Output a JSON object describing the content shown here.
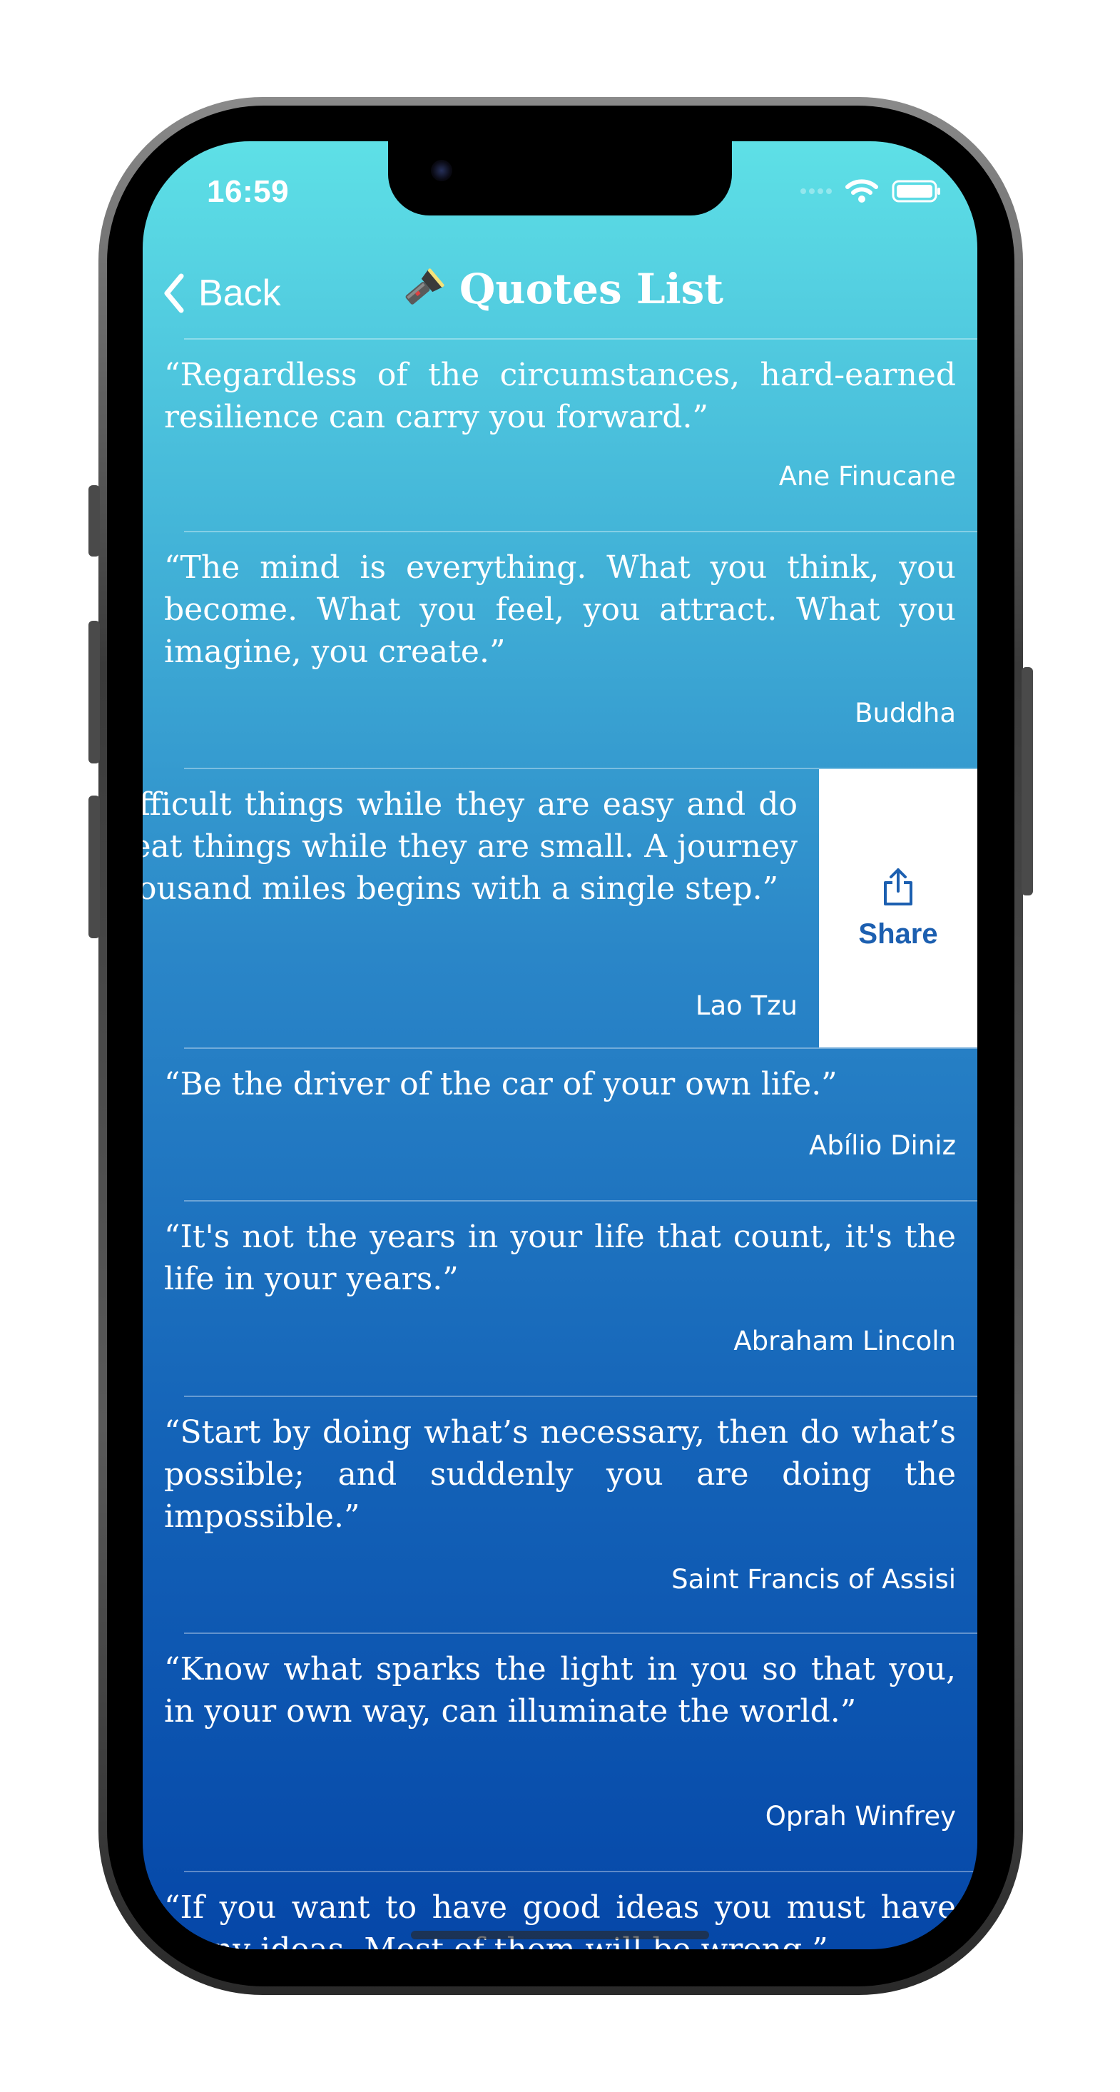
{
  "status_bar": {
    "time": "16:59"
  },
  "nav": {
    "back_label": "Back",
    "title": "Quotes List"
  },
  "quotes": [
    {
      "text": "“Regardless of the circumstances, hard-earned resilience can carry you forward.”",
      "author": "Ane Finucane"
    },
    {
      "text": "“The mind is everything. What you think, you become. What you feel, you attract. What you imagine, you create.”",
      "author": "Buddha"
    },
    {
      "text": "“Do difficult things while they are easy and do the great things while they are small. A journey of a thousand miles begins with a single step.”",
      "author": "Lao Tzu"
    },
    {
      "text": "“Be the driver of the car of your own life.”",
      "author": "Abílio Diniz"
    },
    {
      "text": "“It's not the years in your life that count, it's the life in your years.”",
      "author": "Abraham Lincoln"
    },
    {
      "text": "“Start by doing what’s necessary, then do what’s possible; and suddenly you are doing the impossible.”",
      "author": "Saint Francis of Assisi"
    },
    {
      "text": "“Know what sparks the light in you so that you, in your own way, can illuminate the world.”",
      "author": "Oprah Winfrey"
    },
    {
      "text": "“If you want to have good ideas you must have many ideas. Most of them will be wrong.”",
      "author": ""
    }
  ],
  "swipe_action": {
    "label": "Share",
    "icon": "share-icon",
    "color": "#1c5fb0"
  },
  "colors": {
    "gradient_top": "#5ee0e6",
    "gradient_bottom": "#0547a8"
  }
}
